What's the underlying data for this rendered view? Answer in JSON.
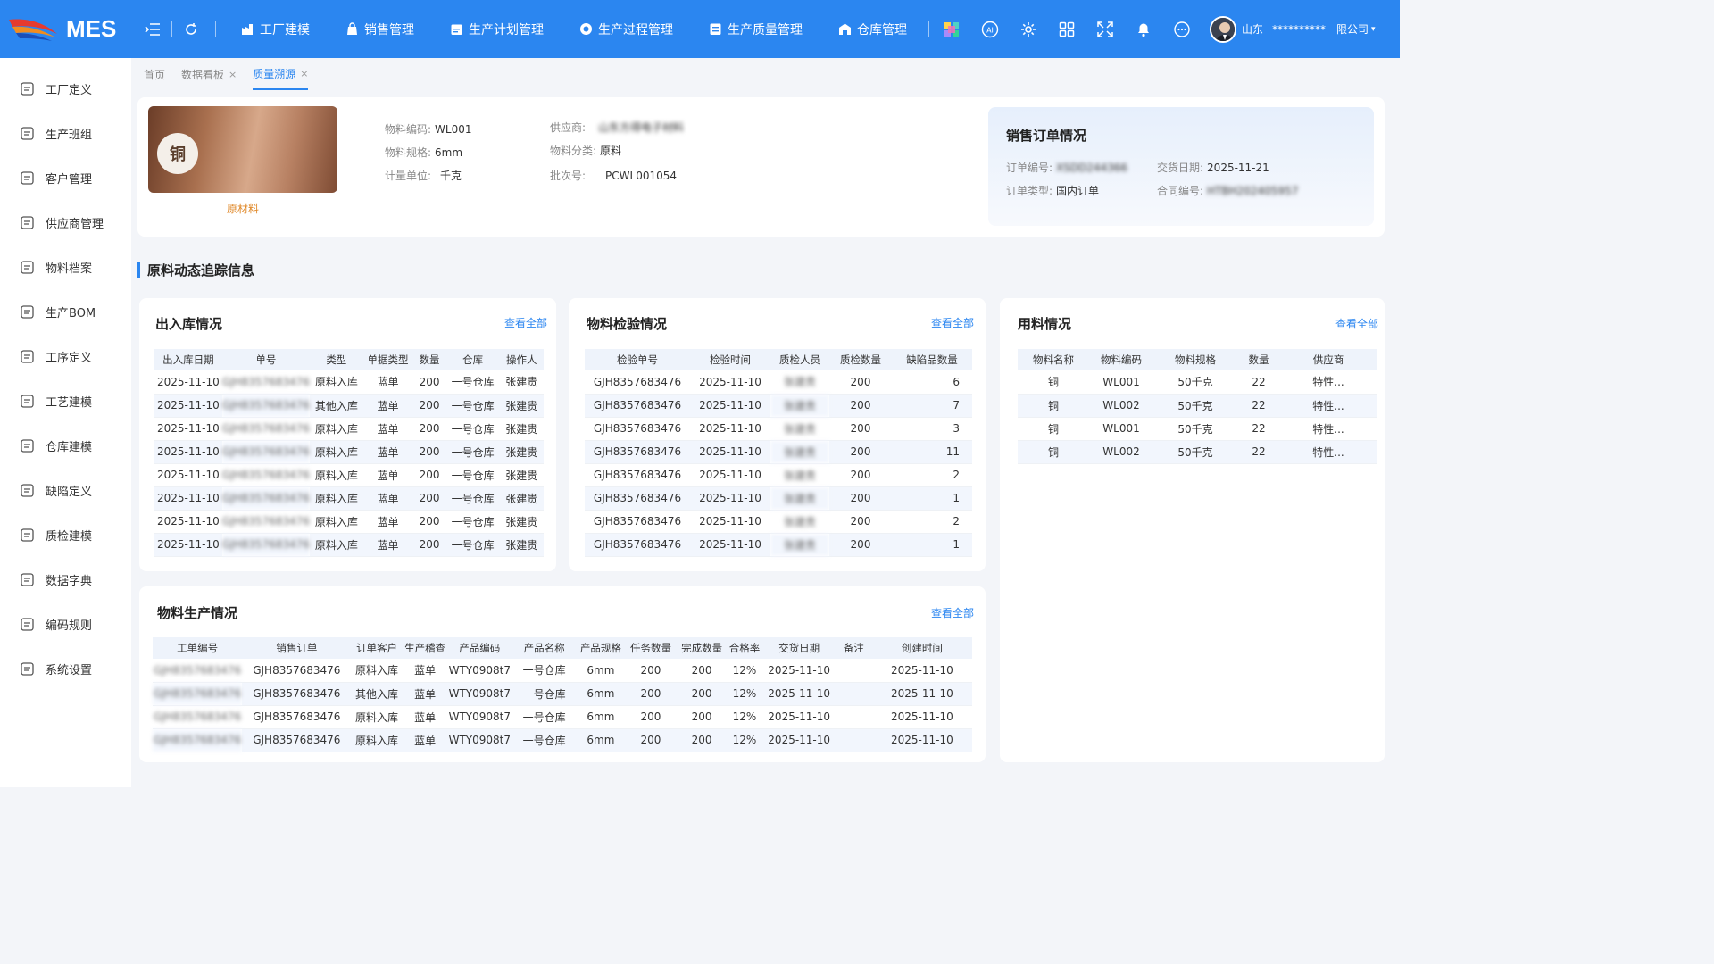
{
  "app": {
    "name": "MES"
  },
  "nav": [
    {
      "label": "工厂建模",
      "icon": "factory-icon"
    },
    {
      "label": "销售管理",
      "icon": "bag-icon"
    },
    {
      "label": "生产计划管理",
      "icon": "calendar-icon"
    },
    {
      "label": "生产过程管理",
      "icon": "process-icon"
    },
    {
      "label": "生产质量管理",
      "icon": "quality-icon"
    },
    {
      "label": "仓库管理",
      "icon": "warehouse-icon"
    }
  ],
  "user": {
    "region": "山东",
    "name": "**********",
    "company": "限公司"
  },
  "sidebar": [
    {
      "label": "工厂定义",
      "icon": "factory-def-icon"
    },
    {
      "label": "生产班组",
      "icon": "team-icon"
    },
    {
      "label": "客户管理",
      "icon": "customer-icon"
    },
    {
      "label": "供应商管理",
      "icon": "supplier-icon"
    },
    {
      "label": "物料档案",
      "icon": "material-icon"
    },
    {
      "label": "生产BOM",
      "icon": "bom-icon"
    },
    {
      "label": "工序定义",
      "icon": "process-def-icon"
    },
    {
      "label": "工艺建模",
      "icon": "craft-icon"
    },
    {
      "label": "仓库建模",
      "icon": "warehouse-model-icon"
    },
    {
      "label": "缺陷定义",
      "icon": "defect-icon"
    },
    {
      "label": "质检建模",
      "icon": "inspection-icon"
    },
    {
      "label": "数据字典",
      "icon": "dictionary-icon"
    },
    {
      "label": "编码规则",
      "icon": "coding-rule-icon"
    },
    {
      "label": "系统设置",
      "icon": "settings-icon"
    }
  ],
  "tabs": [
    {
      "label": "首页",
      "closable": false
    },
    {
      "label": "数据看板",
      "closable": true
    },
    {
      "label": "质量溯源",
      "closable": true,
      "active": true
    }
  ],
  "material": {
    "badge": "铜",
    "type_label": "原材料",
    "code_label": "物料编码:",
    "code": "WL001",
    "spec_label": "物料规格:",
    "spec": "6mm",
    "unit_label": "计量单位:",
    "unit": "千克",
    "supplier_label": "供应商:",
    "supplier": "山东方得电子材料",
    "category_label": "物料分类:",
    "category": "原料",
    "batch_label": "批次号:",
    "batch": "PCWL001054"
  },
  "sales_order": {
    "title": "销售订单情况",
    "order_no_label": "订单编号:",
    "order_no": "XSDD244366",
    "delivery_label": "交货日期:",
    "delivery": "2025-11-21",
    "type_label": "订单类型:",
    "type": "国内订单",
    "contract_label": "合同编号:",
    "contract": "HTBH202405957"
  },
  "section_title": "原料动态追踪信息",
  "view_all": "查看全部",
  "inout": {
    "title": "出入库情况",
    "headers": [
      "出入库日期",
      "单号",
      "类型",
      "单据类型",
      "数量",
      "仓库",
      "操作人"
    ],
    "rows": [
      [
        "2025-11-10",
        "GJH8357683476",
        "原料入库",
        "蓝单",
        "200",
        "一号仓库",
        "张建贵"
      ],
      [
        "2025-11-10",
        "GJH8357683476",
        "其他入库",
        "蓝单",
        "200",
        "一号仓库",
        "张建贵"
      ],
      [
        "2025-11-10",
        "GJH8357683476",
        "原料入库",
        "蓝单",
        "200",
        "一号仓库",
        "张建贵"
      ],
      [
        "2025-11-10",
        "GJH8357683476",
        "原料入库",
        "蓝单",
        "200",
        "一号仓库",
        "张建贵"
      ],
      [
        "2025-11-10",
        "GJH8357683476",
        "原料入库",
        "蓝单",
        "200",
        "一号仓库",
        "张建贵"
      ],
      [
        "2025-11-10",
        "GJH8357683476",
        "原料入库",
        "蓝单",
        "200",
        "一号仓库",
        "张建贵"
      ],
      [
        "2025-11-10",
        "GJH8357683476",
        "原料入库",
        "蓝单",
        "200",
        "一号仓库",
        "张建贵"
      ],
      [
        "2025-11-10",
        "GJH8357683476",
        "原料入库",
        "蓝单",
        "200",
        "一号仓库",
        "张建贵"
      ]
    ]
  },
  "inspection": {
    "title": "物料检验情况",
    "headers": [
      "检验单号",
      "检验时间",
      "质检人员",
      "质检数量",
      "缺陷品数量"
    ],
    "rows": [
      [
        "GJH8357683476",
        "2025-11-10",
        "张建贵",
        "200",
        "6"
      ],
      [
        "GJH8357683476",
        "2025-11-10",
        "张建贵",
        "200",
        "7"
      ],
      [
        "GJH8357683476",
        "2025-11-10",
        "张建贵",
        "200",
        "3"
      ],
      [
        "GJH8357683476",
        "2025-11-10",
        "张建贵",
        "200",
        "11"
      ],
      [
        "GJH8357683476",
        "2025-11-10",
        "张建贵",
        "200",
        "2"
      ],
      [
        "GJH8357683476",
        "2025-11-10",
        "张建贵",
        "200",
        "1"
      ],
      [
        "GJH8357683476",
        "2025-11-10",
        "张建贵",
        "200",
        "2"
      ],
      [
        "GJH8357683476",
        "2025-11-10",
        "张建贵",
        "200",
        "1"
      ]
    ]
  },
  "usage": {
    "title": "用料情况",
    "headers": [
      "物料名称",
      "物料编码",
      "物料规格",
      "数量",
      "供应商"
    ],
    "rows": [
      [
        "铜",
        "WL001",
        "50千克",
        "22",
        "特性..."
      ],
      [
        "铜",
        "WL002",
        "50千克",
        "22",
        "特性..."
      ],
      [
        "铜",
        "WL001",
        "50千克",
        "22",
        "特性..."
      ],
      [
        "铜",
        "WL002",
        "50千克",
        "22",
        "特性..."
      ]
    ]
  },
  "production": {
    "title": "物料生产情况",
    "headers": [
      "工单编号",
      "销售订单",
      "订单客户",
      "生产稽查",
      "产品编码",
      "产品名称",
      "产品规格",
      "任务数量",
      "完成数量",
      "合格率",
      "交货日期",
      "备注",
      "创建时间"
    ],
    "rows": [
      [
        "GJH8357683476",
        "GJH8357683476",
        "原料入库",
        "蓝单",
        "WTY0908t7",
        "一号仓库",
        "6mm",
        "200",
        "200",
        "12%",
        "2025-11-10",
        "",
        "2025-11-10"
      ],
      [
        "GJH8357683476",
        "GJH8357683476",
        "其他入库",
        "蓝单",
        "WTY0908t7",
        "一号仓库",
        "6mm",
        "200",
        "200",
        "12%",
        "2025-11-10",
        "",
        "2025-11-10"
      ],
      [
        "GJH8357683476",
        "GJH8357683476",
        "原料入库",
        "蓝单",
        "WTY0908t7",
        "一号仓库",
        "6mm",
        "200",
        "200",
        "12%",
        "2025-11-10",
        "",
        "2025-11-10"
      ],
      [
        "GJH8357683476",
        "GJH8357683476",
        "原料入库",
        "蓝单",
        "WTY0908t7",
        "一号仓库",
        "6mm",
        "200",
        "200",
        "12%",
        "2025-11-10",
        "",
        "2025-11-10"
      ]
    ]
  },
  "colors": {
    "primary": "#2b86f0",
    "accent_orange": "#e08a2c",
    "table_header": "#eef3fb",
    "row_alt": "#f2f6fd"
  }
}
